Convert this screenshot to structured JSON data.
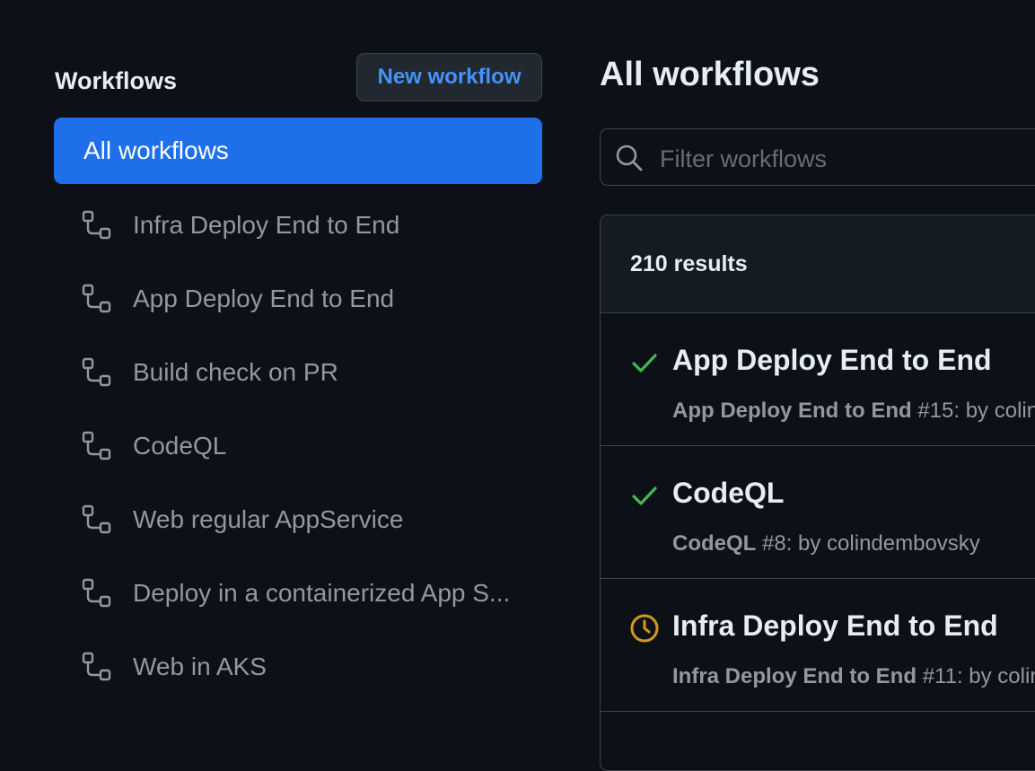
{
  "sidebar": {
    "title": "Workflows",
    "new_workflow_label": "New workflow",
    "active_item": "All workflows",
    "items": [
      {
        "label": "Infra Deploy End to End",
        "icon": "workflow-icon"
      },
      {
        "label": "App Deploy End to End",
        "icon": "workflow-icon"
      },
      {
        "label": "Build check on PR",
        "icon": "workflow-icon"
      },
      {
        "label": "CodeQL",
        "icon": "workflow-icon"
      },
      {
        "label": "Web regular AppService",
        "icon": "workflow-icon"
      },
      {
        "label": "Deploy in a containerized App S...",
        "icon": "workflow-icon"
      },
      {
        "label": "Web in AKS",
        "icon": "workflow-icon"
      }
    ]
  },
  "main": {
    "title": "All workflows",
    "filter": {
      "placeholder": "Filter workflows",
      "icon": "search-icon"
    },
    "results_count": "210 results",
    "runs": [
      {
        "status": "success",
        "title": "App Deploy End to End",
        "workflow": "App Deploy End to End",
        "run_number": "#15",
        "by": ": by colind"
      },
      {
        "status": "success",
        "title": "CodeQL",
        "workflow": "CodeQL",
        "run_number": "#8",
        "by": ": by colindembovsky"
      },
      {
        "status": "queued",
        "title": "Infra Deploy End to End",
        "workflow": "Infra Deploy End to End",
        "run_number": "#11",
        "by": ": by coline"
      }
    ]
  },
  "colors": {
    "background": "#0d1117",
    "accent": "#1f6feb",
    "link": "#4493f8",
    "success": "#3fb950",
    "queued": "#d29922",
    "border": "#3d444d"
  }
}
